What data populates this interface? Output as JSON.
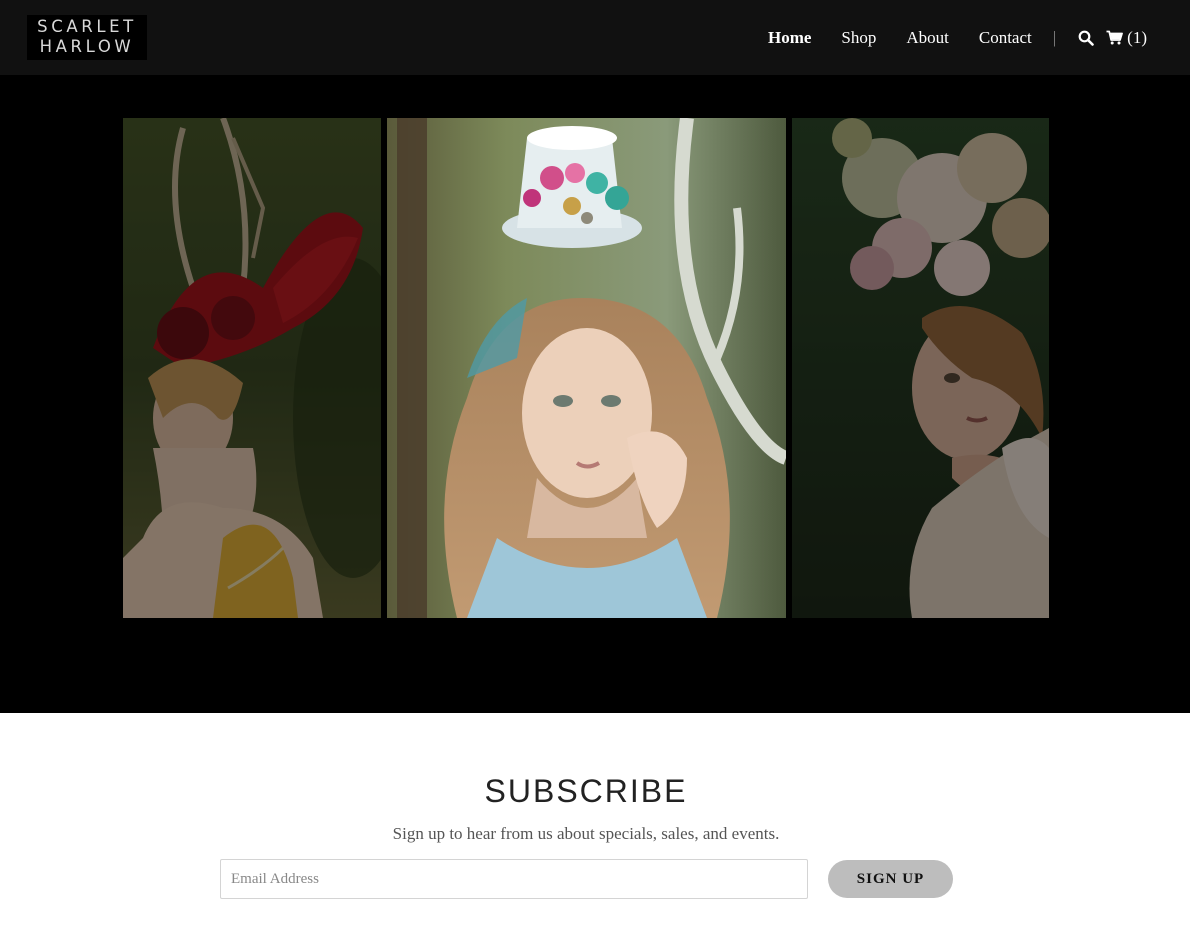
{
  "brand": {
    "line1": "SCARLET",
    "line2": "HARLOW"
  },
  "nav": {
    "items": [
      {
        "label": "Home",
        "active": true
      },
      {
        "label": "Shop",
        "active": false
      },
      {
        "label": "About",
        "active": false
      },
      {
        "label": "Contact",
        "active": false
      }
    ],
    "divider": "|",
    "search_icon": "search-icon",
    "cart_icon": "cart-icon",
    "cart_count": "(1)"
  },
  "hero": {
    "slides": [
      {
        "name": "red-feather-headdress",
        "state": "dimmed"
      },
      {
        "name": "floral-mini-top-hat",
        "state": "active"
      },
      {
        "name": "flower-crown",
        "state": "dimmed"
      }
    ]
  },
  "subscribe": {
    "title": "SUBSCRIBE",
    "text": "Sign up to hear from us about specials, sales, and events.",
    "email_placeholder": "Email Address",
    "email_value": "",
    "button_label": "SIGN UP"
  },
  "colors": {
    "header_bg": "#111111",
    "hero_bg": "#000000",
    "button_bg": "#bdbdbd"
  }
}
